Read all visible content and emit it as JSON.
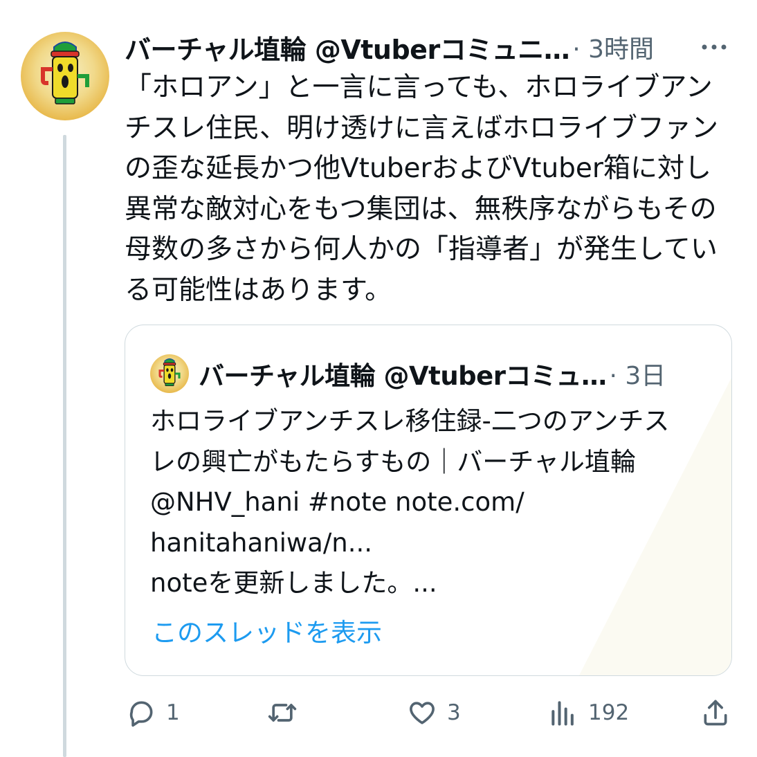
{
  "tweet": {
    "author_name": "バーチャル埴輪 @Vtuberコミュニ…",
    "time_meta": "· 3時間",
    "more_icon": "more-horizontal-icon",
    "text": "「ホロアン」と一言に言っても、ホロライブアン\nチスレ住民、明け透けに言えばホロライブファン\nの歪な延長かつ他VtuberおよびVtuber箱に対し\n異常な敵対心をもつ集団は、無秩序ながらもその\n母数の多さから何人かの「指導者」が発生してい\nる可能性はあります。"
  },
  "quote": {
    "author_name": "バーチャル埴輪 @Vtuberコミュ…",
    "time_meta": "· 3日",
    "text": "ホロライブアンチスレ移住録-二つのアンチス\nレの興亡がもたらすもの｜バーチャル埴輪\n@NHV_hani #note note.com/\nhanitahaniwa/n...\nnoteを更新しました。...",
    "show_thread": "このスレッドを表示"
  },
  "actions": {
    "reply": {
      "icon": "reply-icon",
      "count": "1"
    },
    "retweet": {
      "icon": "retweet-icon",
      "count": ""
    },
    "like": {
      "icon": "heart-icon",
      "count": "3"
    },
    "views": {
      "icon": "views-icon",
      "count": "192"
    },
    "share": {
      "icon": "share-icon"
    }
  },
  "colors": {
    "text": "#0f1419",
    "secondary": "#536471",
    "link": "#1d9bf0",
    "border": "#cfd9de"
  }
}
